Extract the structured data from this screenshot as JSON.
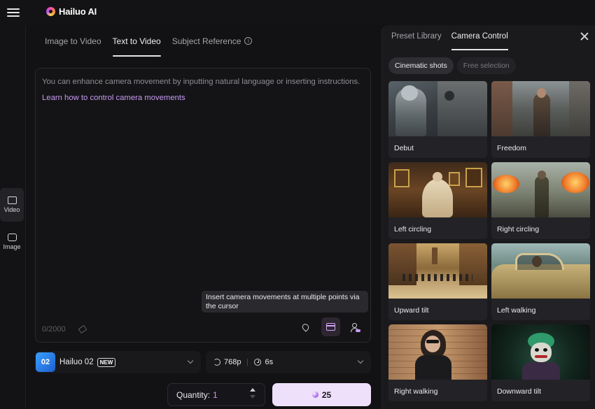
{
  "app": {
    "title": "Hailuo AI"
  },
  "rail": [
    {
      "label": "Video",
      "icon": "video-icon"
    },
    {
      "label": "Image",
      "icon": "image-icon"
    }
  ],
  "tabs": [
    {
      "label": "Image to Video"
    },
    {
      "label": "Text to Video"
    },
    {
      "label": "Subject Reference"
    }
  ],
  "editor": {
    "placeholder": "You can enhance camera movement by inputting natural language or inserting instructions.",
    "link": "Learn how to control camera movements",
    "tooltip": "Insert camera movements at multiple points via the cursor",
    "counter": "0/2000"
  },
  "model": {
    "name": "Hailuo 02",
    "badge": "NEW",
    "thumb_text": "02"
  },
  "settings": {
    "resolution": "768p",
    "duration": "6s"
  },
  "quantity": {
    "label": "Quantity:",
    "value": "1"
  },
  "generate": {
    "cost": "25"
  },
  "panel": {
    "tabs": [
      {
        "label": "Preset Library"
      },
      {
        "label": "Camera Control"
      }
    ],
    "pills": [
      {
        "label": "Cinematic shots"
      },
      {
        "label": "Free selection"
      }
    ],
    "cards": [
      {
        "label": "Debut"
      },
      {
        "label": "Freedom"
      },
      {
        "label": "Left circling"
      },
      {
        "label": "Right circling"
      },
      {
        "label": "Upward tilt"
      },
      {
        "label": "Left walking"
      },
      {
        "label": "Right walking"
      },
      {
        "label": "Downward tilt"
      }
    ]
  },
  "colors": {
    "accent": "#c89bf0",
    "generate_bg": "#eee0fb",
    "background": "#111113"
  }
}
